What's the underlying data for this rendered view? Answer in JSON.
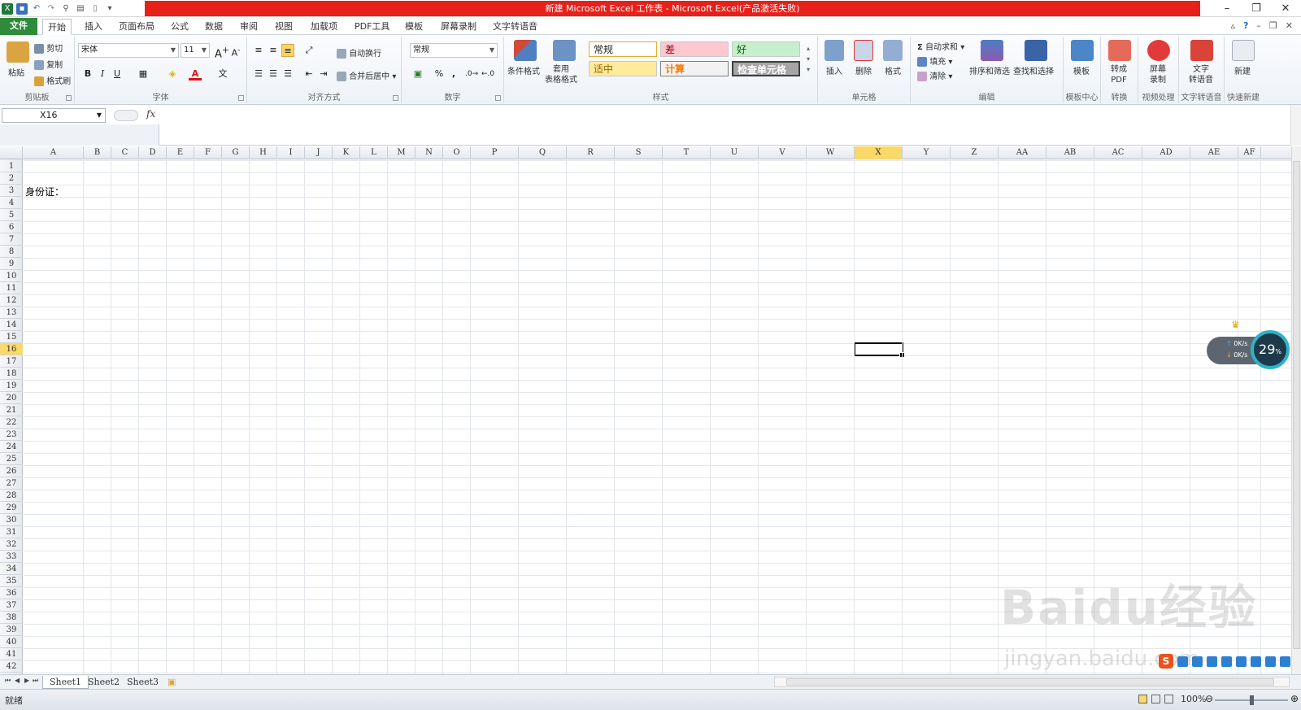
{
  "window": {
    "title": "新建 Microsoft Excel 工作表 - Microsoft Excel(产品激活失败)",
    "controls": [
      "–",
      "❐",
      "✕"
    ]
  },
  "tabs": [
    "文件",
    "开始",
    "插入",
    "页面布局",
    "公式",
    "数据",
    "审阅",
    "视图",
    "加载项",
    "PDF工具",
    "模板",
    "屏幕录制",
    "文字转语音"
  ],
  "active_tab": "开始",
  "ribbon": {
    "clipboard": {
      "paste": "粘贴",
      "cut": "剪切",
      "copy": "复制",
      "format_painter": "格式刷",
      "label": "剪贴板"
    },
    "font": {
      "font_name": "宋体",
      "font_size": "11",
      "bold": "B",
      "italic": "I",
      "underline": "U",
      "label": "字体"
    },
    "alignment": {
      "wrap_text": "自动换行",
      "merge_center": "合并后居中",
      "label": "对齐方式"
    },
    "number": {
      "format": "常规",
      "percent": "%",
      "comma": ",",
      "label": "数字"
    },
    "styles": {
      "conditional": "条件格式",
      "table_format": "套用\n表格格式",
      "cells": [
        "常规",
        "差",
        "好",
        "适中",
        "计算",
        "检查单元格"
      ],
      "label": "样式"
    },
    "cells_group": {
      "insert": "插入",
      "delete": "删除",
      "format": "格式",
      "label": "单元格"
    },
    "editing": {
      "autosum": "自动求和",
      "fill": "填充",
      "clear": "清除",
      "sort_filter": "排序和筛选",
      "find_select": "查找和选择",
      "label": "编辑"
    },
    "extras": [
      {
        "btn": "模板",
        "label": "模板中心"
      },
      {
        "btn": "转成\nPDF",
        "label": "转换"
      },
      {
        "btn": "屏幕\n录制",
        "label": "视频处理"
      },
      {
        "btn": "文字\n转语音",
        "label": "文字转语音"
      },
      {
        "btn": "新建",
        "label": "快速新建"
      }
    ]
  },
  "formula_bar": {
    "name_box": "X16",
    "fx": "fx",
    "value": ""
  },
  "columns": [
    "A",
    "B",
    "C",
    "D",
    "E",
    "F",
    "G",
    "H",
    "I",
    "J",
    "K",
    "L",
    "M",
    "N",
    "O",
    "P",
    "Q",
    "R",
    "S",
    "T",
    "U",
    "V",
    "W",
    "X",
    "Y",
    "Z",
    "AA",
    "AB",
    "AC",
    "AD",
    "AE",
    "AF"
  ],
  "selected_column": "X",
  "selected_row": 16,
  "cells": {
    "A3": "身份证："
  },
  "sheets": [
    "Sheet1",
    "Sheet2",
    "Sheet3"
  ],
  "active_sheet": "Sheet1",
  "status": {
    "text": "就绪",
    "zoom": "100%"
  },
  "speed_widget": {
    "up": "0K/s",
    "down": "0K/s",
    "percent": "29",
    "percent_sign": "%"
  },
  "watermark": {
    "main": "Baidu经验",
    "sub": "jingyan.baidu.com"
  },
  "colors": {
    "title_red": "#e8201a",
    "file_tab": "#2e8b3a",
    "selection_header": "#fbd86a"
  }
}
